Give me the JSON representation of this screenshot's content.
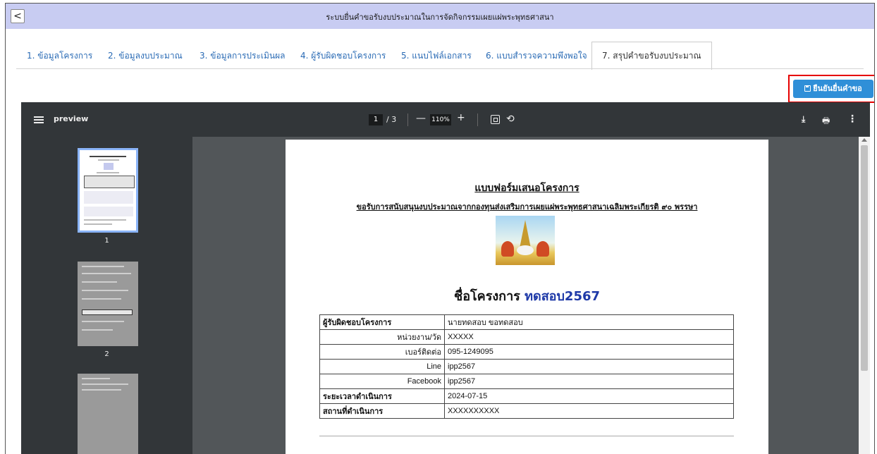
{
  "header": {
    "back_label": "<",
    "title": "ระบบยื่นคำขอรับงบประมาณในการจัดกิจกรรมเผยแผ่พระพุทธศาสนา"
  },
  "tabs": [
    {
      "label": "1. ข้อมูลโครงการ"
    },
    {
      "label": "2. ข้อมูลงบประมาณ"
    },
    {
      "label": "3. ข้อมูลการประเมินผล"
    },
    {
      "label": "4. ผู้รับผิดชอบโครงการ"
    },
    {
      "label": "5. แนบไฟล์เอกสาร"
    },
    {
      "label": "6. แบบสำรวจความพึงพอใจ"
    },
    {
      "label": "7. สรุปคำขอรับงบประมาณ"
    }
  ],
  "actions": {
    "confirm_label": "ยืนยันยื่นคำขอ"
  },
  "viewer": {
    "title": "preview",
    "page_current": "1",
    "page_total": "/ 3",
    "zoom": "110%",
    "zoom_out": "—",
    "zoom_in": "+",
    "thumbnails": [
      {
        "label": "1"
      },
      {
        "label": "2"
      }
    ]
  },
  "document": {
    "title": "แบบฟอร์มเสนอโครงการ",
    "subtitle": "ขอรับการสนับสนุนงบประมาณจากกองทุนส่งเสริมการเผยแผ่พระพุทธศาสนาเฉลิมพระเกียรติ ๙๐ พรรษา",
    "project_label": "ชื่อโครงการ",
    "project_name": "ทดสอบ2567",
    "rows": [
      {
        "key": "ผู้รับผิดชอบโครงการ",
        "value": "นายทดสอบ ขอทดสอบ"
      },
      {
        "key": "หน่วยงาน/วัด",
        "value": "XXXXX"
      },
      {
        "key": "เบอร์ติดต่อ",
        "value": "095-1249095"
      },
      {
        "key": "Line",
        "value": "ipp2567"
      },
      {
        "key": "Facebook",
        "value": "ipp2567"
      },
      {
        "key": "ระยะเวลาดำเนินการ",
        "value": "2024-07-15"
      },
      {
        "key": "สถานที่ดำเนินการ",
        "value": "XXXXXXXXXX"
      }
    ]
  }
}
